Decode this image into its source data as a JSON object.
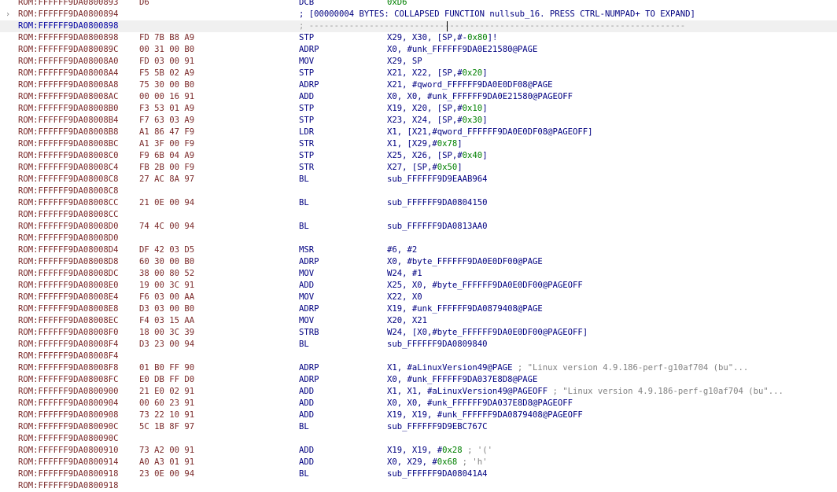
{
  "lines": [
    {
      "addr": "ROM:FFFFFF9DA0800893",
      "bytes": "D6",
      "mn": "DCB",
      "ops": [
        {
          "t": "0xD6",
          "n": 1
        }
      ]
    },
    {
      "addr": "ROM:FFFFFF9DA0800894",
      "arrow": "›",
      "comment": "; [00000004 BYTES: COLLAPSED FUNCTION nullsub_16. PRESS CTRL-NUMPAD+ TO EXPAND]"
    },
    {
      "addr": "ROM:FFFFFF9DA0800898",
      "comment": "; ---------------------------------------------------------------------------",
      "dash": true,
      "hl": true,
      "sel": true
    },
    {
      "addr": "ROM:FFFFFF9DA0800898",
      "bytes": "FD 7B B8 A9",
      "mn": "STP",
      "ops": [
        {
          "t": "X29, X30, [SP,#-"
        },
        {
          "t": "0x80",
          "n": 1
        },
        {
          "t": "]!"
        }
      ]
    },
    {
      "addr": "ROM:FFFFFF9DA080089C",
      "bytes": "00 31 00 B0",
      "mn": "ADRP",
      "ops": [
        {
          "t": "X0, #unk_FFFFFF9DA0E21580@PAGE"
        }
      ]
    },
    {
      "addr": "ROM:FFFFFF9DA08008A0",
      "bytes": "FD 03 00 91",
      "mn": "MOV",
      "ops": [
        {
          "t": "X29, SP"
        }
      ]
    },
    {
      "addr": "ROM:FFFFFF9DA08008A4",
      "bytes": "F5 5B 02 A9",
      "mn": "STP",
      "ops": [
        {
          "t": "X21, X22, [SP,#"
        },
        {
          "t": "0x20",
          "n": 1
        },
        {
          "t": "]"
        }
      ]
    },
    {
      "addr": "ROM:FFFFFF9DA08008A8",
      "bytes": "75 30 00 B0",
      "mn": "ADRP",
      "ops": [
        {
          "t": "X21, #qword_FFFFFF9DA0E0DF08@PAGE"
        }
      ]
    },
    {
      "addr": "ROM:FFFFFF9DA08008AC",
      "bytes": "00 00 16 91",
      "mn": "ADD",
      "ops": [
        {
          "t": "X0, X0, #unk_FFFFFF9DA0E21580@PAGEOFF"
        }
      ]
    },
    {
      "addr": "ROM:FFFFFF9DA08008B0",
      "bytes": "F3 53 01 A9",
      "mn": "STP",
      "ops": [
        {
          "t": "X19, X20, [SP,#"
        },
        {
          "t": "0x10",
          "n": 1
        },
        {
          "t": "]"
        }
      ]
    },
    {
      "addr": "ROM:FFFFFF9DA08008B4",
      "bytes": "F7 63 03 A9",
      "mn": "STP",
      "ops": [
        {
          "t": "X23, X24, [SP,#"
        },
        {
          "t": "0x30",
          "n": 1
        },
        {
          "t": "]"
        }
      ]
    },
    {
      "addr": "ROM:FFFFFF9DA08008B8",
      "bytes": "A1 86 47 F9",
      "mn": "LDR",
      "ops": [
        {
          "t": "X1, [X21,#qword_FFFFFF9DA0E0DF08@PAGEOFF]"
        }
      ]
    },
    {
      "addr": "ROM:FFFFFF9DA08008BC",
      "bytes": "A1 3F 00 F9",
      "mn": "STR",
      "ops": [
        {
          "t": "X1, [X29,#"
        },
        {
          "t": "0x78",
          "n": 1
        },
        {
          "t": "]"
        }
      ]
    },
    {
      "addr": "ROM:FFFFFF9DA08008C0",
      "bytes": "F9 6B 04 A9",
      "mn": "STP",
      "ops": [
        {
          "t": "X25, X26, [SP,#"
        },
        {
          "t": "0x40",
          "n": 1
        },
        {
          "t": "]"
        }
      ]
    },
    {
      "addr": "ROM:FFFFFF9DA08008C4",
      "bytes": "FB 2B 00 F9",
      "mn": "STR",
      "ops": [
        {
          "t": "X27, [SP,#"
        },
        {
          "t": "0x50",
          "n": 1
        },
        {
          "t": "]"
        }
      ]
    },
    {
      "addr": "ROM:FFFFFF9DA08008C8",
      "bytes": "27 AC 8A 97",
      "mn": "BL",
      "ops": [
        {
          "t": "sub_FFFFFF9D9EAAB964"
        }
      ]
    },
    {
      "addr": "ROM:FFFFFF9DA08008C8"
    },
    {
      "addr": "ROM:FFFFFF9DA08008CC",
      "bytes": "21 0E 00 94",
      "mn": "BL",
      "ops": [
        {
          "t": "sub_FFFFFF9DA0804150"
        }
      ]
    },
    {
      "addr": "ROM:FFFFFF9DA08008CC"
    },
    {
      "addr": "ROM:FFFFFF9DA08008D0",
      "bytes": "74 4C 00 94",
      "mn": "BL",
      "ops": [
        {
          "t": "sub_FFFFFF9DA0813AA0"
        }
      ]
    },
    {
      "addr": "ROM:FFFFFF9DA08008D0"
    },
    {
      "addr": "ROM:FFFFFF9DA08008D4",
      "bytes": "DF 42 03 D5",
      "mn": "MSR",
      "ops": [
        {
          "t": "#6, #2"
        }
      ]
    },
    {
      "addr": "ROM:FFFFFF9DA08008D8",
      "bytes": "60 30 00 B0",
      "mn": "ADRP",
      "ops": [
        {
          "t": "X0, #byte_FFFFFF9DA0E0DF00@PAGE"
        }
      ]
    },
    {
      "addr": "ROM:FFFFFF9DA08008DC",
      "bytes": "38 00 80 52",
      "mn": "MOV",
      "ops": [
        {
          "t": "W24, #1"
        }
      ]
    },
    {
      "addr": "ROM:FFFFFF9DA08008E0",
      "bytes": "19 00 3C 91",
      "mn": "ADD",
      "ops": [
        {
          "t": "X25, X0, #byte_FFFFFF9DA0E0DF00@PAGEOFF"
        }
      ]
    },
    {
      "addr": "ROM:FFFFFF9DA08008E4",
      "bytes": "F6 03 00 AA",
      "mn": "MOV",
      "ops": [
        {
          "t": "X22, X0"
        }
      ]
    },
    {
      "addr": "ROM:FFFFFF9DA08008E8",
      "bytes": "D3 03 00 B0",
      "mn": "ADRP",
      "ops": [
        {
          "t": "X19, #unk_FFFFFF9DA0879408@PAGE"
        }
      ]
    },
    {
      "addr": "ROM:FFFFFF9DA08008EC",
      "bytes": "F4 03 15 AA",
      "mn": "MOV",
      "ops": [
        {
          "t": "X20, X21"
        }
      ]
    },
    {
      "addr": "ROM:FFFFFF9DA08008F0",
      "bytes": "18 00 3C 39",
      "mn": "STRB",
      "ops": [
        {
          "t": "W24, [X0,#byte_FFFFFF9DA0E0DF00@PAGEOFF]"
        }
      ]
    },
    {
      "addr": "ROM:FFFFFF9DA08008F4",
      "bytes": "D3 23 00 94",
      "mn": "BL",
      "ops": [
        {
          "t": "sub_FFFFFF9DA0809840"
        }
      ]
    },
    {
      "addr": "ROM:FFFFFF9DA08008F4"
    },
    {
      "addr": "ROM:FFFFFF9DA08008F8",
      "bytes": "01 B0 FF 90",
      "mn": "ADRP",
      "ops": [
        {
          "t": "X1, #aLinuxVersion49@PAGE"
        },
        {
          "t": " ; \"Linux version 4.9.186-perf-g10af704 (bu\"...",
          "c": 1
        }
      ]
    },
    {
      "addr": "ROM:FFFFFF9DA08008FC",
      "bytes": "E0 DB FF D0",
      "mn": "ADRP",
      "ops": [
        {
          "t": "X0, #unk_FFFFFF9DA037E8D8@PAGE"
        }
      ]
    },
    {
      "addr": "ROM:FFFFFF9DA0800900",
      "bytes": "21 E0 02 91",
      "mn": "ADD",
      "ops": [
        {
          "t": "X1, X1, #aLinuxVersion49@PAGEOFF"
        },
        {
          "t": " ; \"Linux version 4.9.186-perf-g10af704 (bu\"...",
          "c": 1
        }
      ]
    },
    {
      "addr": "ROM:FFFFFF9DA0800904",
      "bytes": "00 60 23 91",
      "mn": "ADD",
      "ops": [
        {
          "t": "X0, X0, #unk_FFFFFF9DA037E8D8@PAGEOFF"
        }
      ]
    },
    {
      "addr": "ROM:FFFFFF9DA0800908",
      "bytes": "73 22 10 91",
      "mn": "ADD",
      "ops": [
        {
          "t": "X19, X19, #unk_FFFFFF9DA0879408@PAGEOFF"
        }
      ]
    },
    {
      "addr": "ROM:FFFFFF9DA080090C",
      "bytes": "5C 1B 8F 97",
      "mn": "BL",
      "ops": [
        {
          "t": "sub_FFFFFF9D9EBC767C"
        }
      ]
    },
    {
      "addr": "ROM:FFFFFF9DA080090C"
    },
    {
      "addr": "ROM:FFFFFF9DA0800910",
      "bytes": "73 A2 00 91",
      "mn": "ADD",
      "ops": [
        {
          "t": "X19, X19, #"
        },
        {
          "t": "0x28",
          "n": 1
        },
        {
          "t": " ; '('",
          "c": 1
        }
      ]
    },
    {
      "addr": "ROM:FFFFFF9DA0800914",
      "bytes": "A0 A3 01 91",
      "mn": "ADD",
      "ops": [
        {
          "t": "X0, X29, #"
        },
        {
          "t": "0x68",
          "n": 1
        },
        {
          "t": " ; 'h'",
          "c": 1
        }
      ]
    },
    {
      "addr": "ROM:FFFFFF9DA0800918",
      "bytes": "23 0E 00 94",
      "mn": "BL",
      "ops": [
        {
          "t": "sub_FFFFFF9DA08041A4"
        }
      ]
    },
    {
      "addr": "ROM:FFFFFF9DA0800918"
    }
  ]
}
